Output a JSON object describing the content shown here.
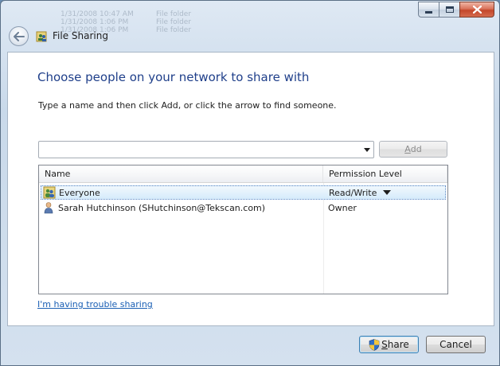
{
  "window": {
    "title": "File Sharing",
    "background_rows": [
      {
        "date": "1/31/2008 10:47 AM",
        "type": "File folder"
      },
      {
        "date": "1/31/2008 1:06 PM",
        "type": "File folder"
      },
      {
        "date": "1/31/2008 1:06 PM",
        "type": "File folder"
      }
    ]
  },
  "content": {
    "heading": "Choose people on your network to share with",
    "instructions": "Type a name and then click Add, or click the arrow to find someone.",
    "name_input": {
      "value": "",
      "placeholder": ""
    },
    "add_button": {
      "prefix": "",
      "accel": "A",
      "suffix": "dd"
    },
    "list": {
      "columns": [
        "Name",
        "Permission Level"
      ],
      "rows": [
        {
          "name": "Everyone",
          "permission": "Read/Write",
          "icon": "group-icon",
          "selected": true,
          "has_dropdown": true
        },
        {
          "name": "Sarah Hutchinson (SHutchinson@Tekscan.com)",
          "permission": "Owner",
          "icon": "user-icon",
          "selected": false,
          "has_dropdown": false
        }
      ]
    },
    "trouble_link": "I'm having trouble sharing"
  },
  "buttons": {
    "share": {
      "accel": "S",
      "suffix": "hare"
    },
    "cancel": "Cancel"
  },
  "colors": {
    "heading": "#1f3f8a",
    "link": "#1a5fb4",
    "close_button": "#c3462a"
  }
}
